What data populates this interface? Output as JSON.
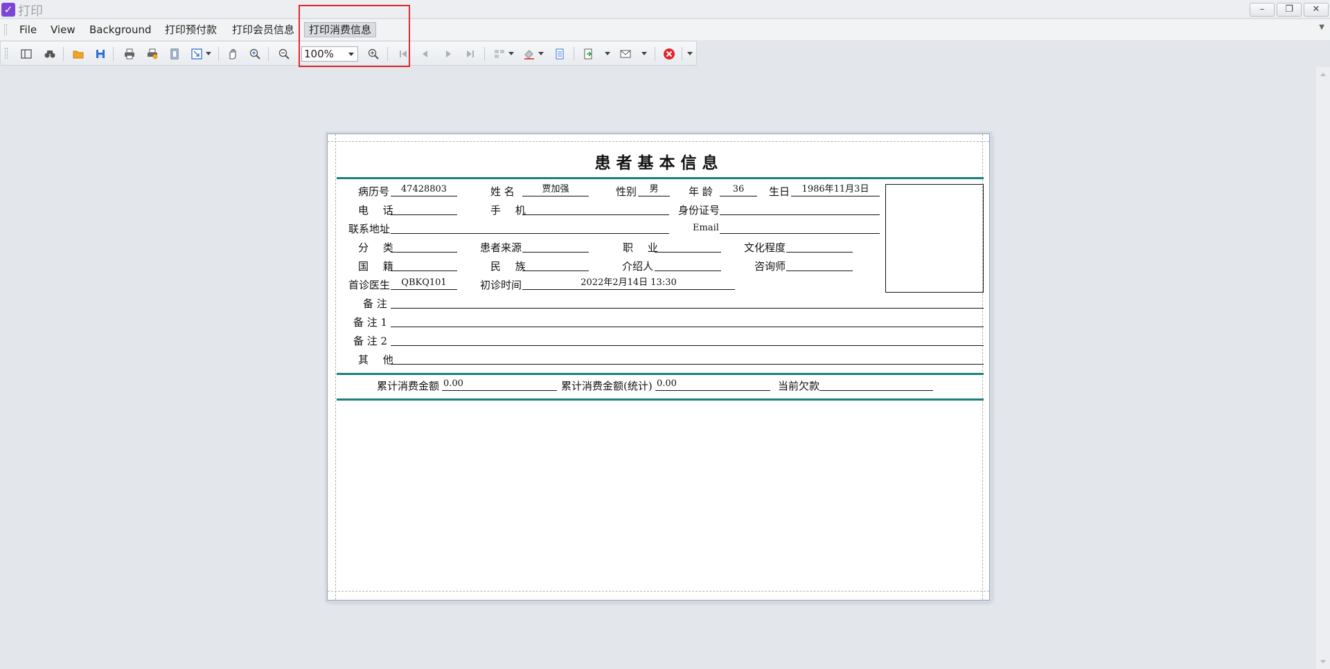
{
  "window": {
    "title": "打印",
    "minimize": "–",
    "restore": "❐",
    "close": "✕"
  },
  "menu": {
    "items": [
      "File",
      "View",
      "Background",
      "打印预付款",
      "打印会员信息",
      "打印消费信息"
    ]
  },
  "toolbar": {
    "zoom_value": "100%",
    "icons": [
      "toggle-panel-icon",
      "find-icon",
      "open-icon",
      "save-icon",
      "print-icon",
      "quick-print-icon",
      "page-setup-icon",
      "scale-icon",
      "hand-tool-icon",
      "magnifier-icon",
      "zoom-out-icon",
      "zoom-in-icon",
      "first-page-icon",
      "previous-page-icon",
      "next-page-icon",
      "last-page-icon",
      "multiple-pages-icon",
      "background-color-icon",
      "watermark-icon",
      "export-icon",
      "email-icon",
      "close-preview-icon"
    ]
  },
  "document": {
    "title": "患者基本信息",
    "labels": {
      "record_no": "病历号",
      "name": "姓  名",
      "gender": "性别",
      "age": "年  龄",
      "birthday": "生日",
      "phone": "电  话",
      "mobile": "手  机",
      "id_no": "身份证号",
      "address": "联系地址",
      "email": "Email",
      "category": "分  类",
      "source": "患者来源",
      "occupation": "职  业",
      "education": "文化程度",
      "nationality": "国  籍",
      "ethnicity": "民  族",
      "referrer": "介绍人",
      "consultant": "咨询师",
      "first_doctor": "首诊医生",
      "first_visit": "初诊时间",
      "remark": "备 注",
      "remark1": "备 注 1",
      "remark2": "备 注 2",
      "other": "其  他",
      "total_spent": "累计消费金额",
      "total_spent_stat": "累计消费金额(统计)",
      "current_debt": "当前欠款"
    },
    "values": {
      "record_no": "47428803",
      "name": "贾加强",
      "gender": "男",
      "age": "36",
      "birthday": "1986年11月3日",
      "phone": "",
      "mobile": "",
      "id_no": "",
      "address": "",
      "email": "",
      "category": "",
      "source": "",
      "occupation": "",
      "education": "",
      "nationality": "",
      "ethnicity": "",
      "referrer": "",
      "consultant": "",
      "first_doctor": "QBKQ101",
      "first_visit": "2022年2月14日 13:30",
      "remark": "",
      "remark1": "",
      "remark2": "",
      "other": "",
      "total_spent": "0.00",
      "total_spent_stat": "0.00",
      "current_debt": ""
    }
  },
  "colors": {
    "accent_teal": "#1a8079",
    "highlight_red": "#e0262b",
    "app_icon": "#7b45d8"
  }
}
